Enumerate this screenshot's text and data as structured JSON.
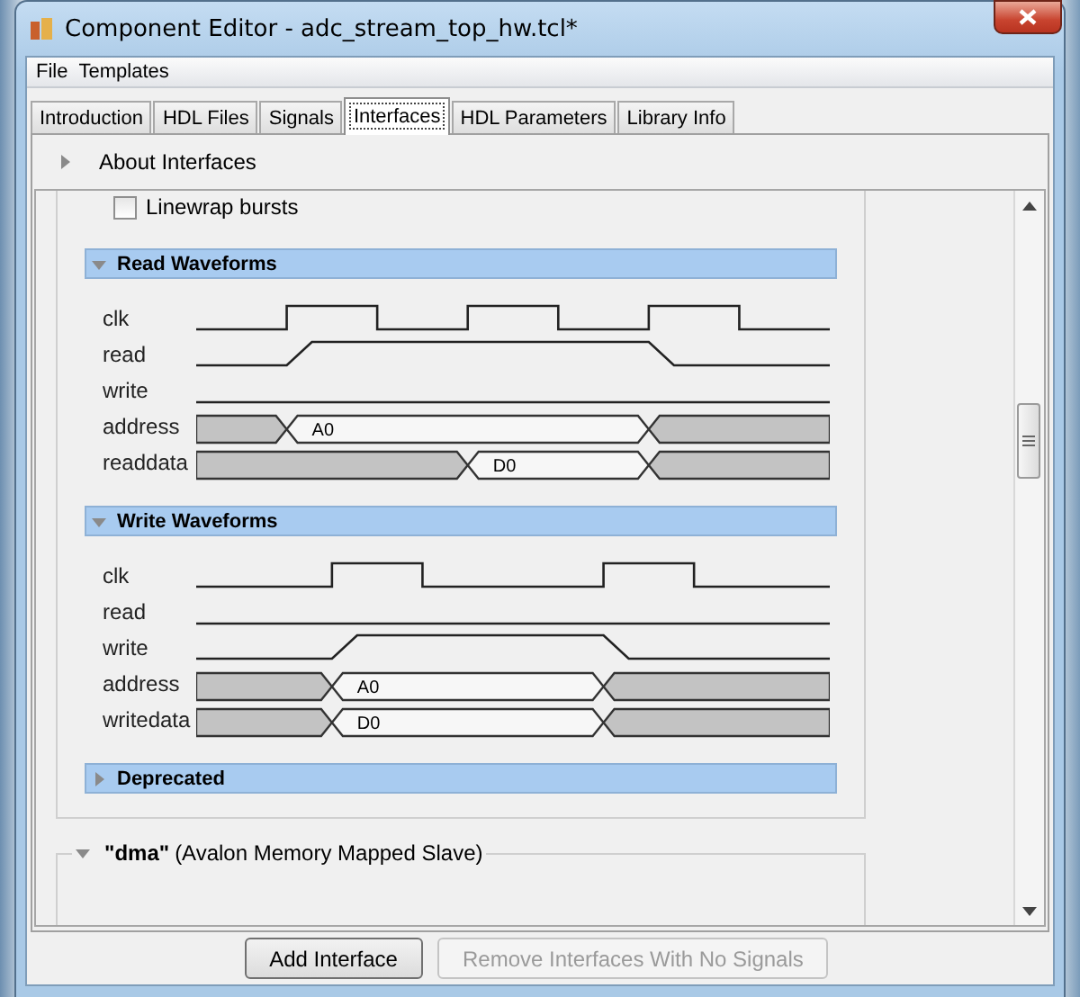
{
  "window": {
    "title": "Component Editor - adc_stream_top_hw.tcl*"
  },
  "menu": [
    "File",
    "Templates"
  ],
  "tabs": [
    {
      "label": "Introduction",
      "selected": false
    },
    {
      "label": "HDL Files",
      "selected": false
    },
    {
      "label": "Signals",
      "selected": false
    },
    {
      "label": "Interfaces",
      "selected": true
    },
    {
      "label": "HDL Parameters",
      "selected": false
    },
    {
      "label": "Library Info",
      "selected": false
    }
  ],
  "about": {
    "label": "About Interfaces",
    "expanded": false
  },
  "linewrap": {
    "label": "Linewrap bursts",
    "checked": false
  },
  "sections": [
    {
      "title": "Read Waveforms",
      "kind": "read",
      "expanded": true,
      "signals": [
        {
          "name": "clk",
          "kind": "clock"
        },
        {
          "name": "read",
          "kind": "strobe"
        },
        {
          "name": "write",
          "kind": "idle"
        },
        {
          "name": "address",
          "kind": "request",
          "value": "A0"
        },
        {
          "name": "readdata",
          "kind": "response",
          "value": "D0"
        }
      ]
    },
    {
      "title": "Write Waveforms",
      "kind": "write",
      "expanded": true,
      "signals": [
        {
          "name": "clk",
          "kind": "clock"
        },
        {
          "name": "read",
          "kind": "idle"
        },
        {
          "name": "write",
          "kind": "strobe"
        },
        {
          "name": "address",
          "kind": "request",
          "value": "A0"
        },
        {
          "name": "writedata",
          "kind": "request",
          "value": "D0"
        }
      ]
    },
    {
      "title": "Deprecated",
      "expanded": false
    }
  ],
  "interface": {
    "name": "\"dma\"",
    "type": "(Avalon Memory Mapped Slave)",
    "expanded": true
  },
  "buttons": [
    {
      "label": "Add Interface",
      "disabled": false
    },
    {
      "label": "Remove Interfaces With No Signals",
      "disabled": true
    }
  ]
}
